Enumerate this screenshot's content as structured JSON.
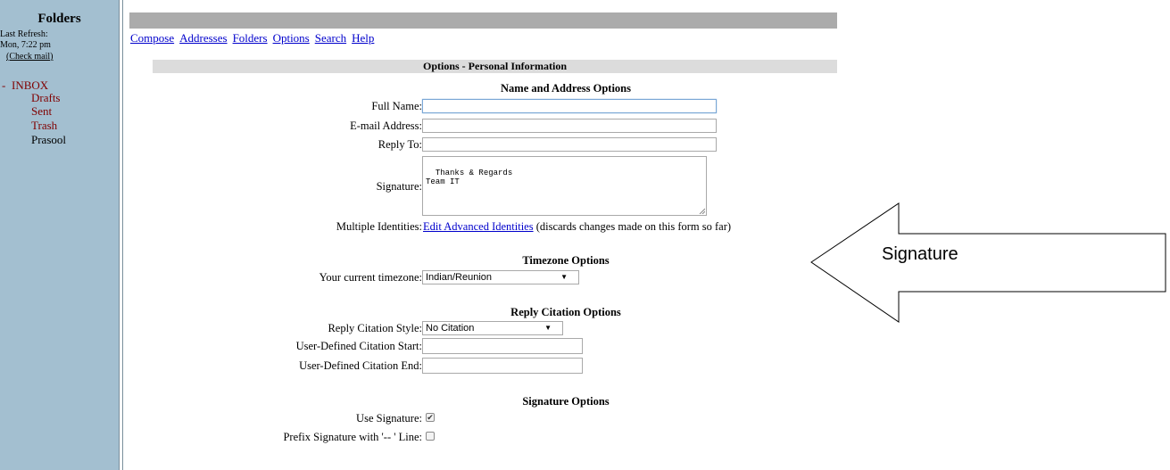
{
  "sidebar": {
    "title": "Folders",
    "last_refresh_label": "Last Refresh:",
    "last_refresh_time": "Mon, 7:22 pm",
    "check_mail": "(Check mail)",
    "inbox_prefix": "-",
    "folders": [
      "INBOX",
      "Drafts",
      "Sent",
      "Trash",
      "Prasool"
    ]
  },
  "nav": [
    "Compose",
    "Addresses",
    "Folders",
    "Options",
    "Search",
    "Help"
  ],
  "panel_title": "Options - Personal Information",
  "name_section": {
    "title": "Name and Address Options",
    "full_name_label": "Full Name:",
    "full_name_value": "",
    "email_label": "E-mail Address:",
    "email_value": "",
    "reply_to_label": "Reply To:",
    "reply_to_value": "",
    "signature_label": "Signature:",
    "signature_value": "Thanks & Regards\nTeam IT",
    "identities_label": "Multiple Identities:",
    "identities_link": "Edit Advanced Identities",
    "identities_note": "(discards changes made on this form so far)"
  },
  "timezone_section": {
    "title": "Timezone Options",
    "label": "Your current timezone:",
    "value": "Indian/Reunion"
  },
  "reply_section": {
    "title": "Reply Citation Options",
    "style_label": "Reply Citation Style:",
    "style_value": "No Citation",
    "start_label": "User-Defined Citation Start:",
    "start_value": "",
    "end_label": "User-Defined Citation End:",
    "end_value": ""
  },
  "signature_section": {
    "title": "Signature Options",
    "use_label": "Use Signature:",
    "use_checked": true,
    "prefix_label": "Prefix Signature with '-- ' Line:",
    "prefix_checked": false,
    "check_glyph": "✔"
  },
  "callout": {
    "text": "Signature"
  },
  "colors": {
    "sidebar_bg": "#a3bfd0",
    "folder_text": "#800000",
    "link": "#0000cc",
    "header_bar": "#ababab",
    "panel_header": "#dcdcdc"
  }
}
